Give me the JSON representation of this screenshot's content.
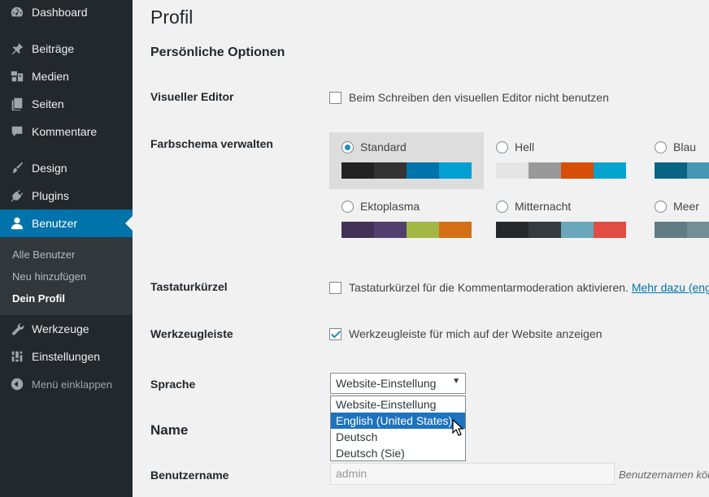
{
  "sidebar": {
    "items": [
      {
        "label": "Dashboard",
        "icon": "dashboard-icon"
      },
      {
        "label": "Beiträge",
        "icon": "pin-icon"
      },
      {
        "label": "Medien",
        "icon": "media-icon"
      },
      {
        "label": "Seiten",
        "icon": "pages-icon"
      },
      {
        "label": "Kommentare",
        "icon": "comment-icon"
      },
      {
        "label": "Design",
        "icon": "brush-icon"
      },
      {
        "label": "Plugins",
        "icon": "plug-icon"
      },
      {
        "label": "Benutzer",
        "icon": "user-icon"
      },
      {
        "label": "Werkzeuge",
        "icon": "wrench-icon"
      },
      {
        "label": "Einstellungen",
        "icon": "settings-icon"
      }
    ],
    "submenu": [
      "Alle Benutzer",
      "Neu hinzufügen",
      "Dein Profil"
    ],
    "collapse_label": "Menü einklappen",
    "active_color": "#0073aa"
  },
  "page": {
    "title": "Profil",
    "section_personal": "Persönliche Optionen",
    "visual_editor": {
      "label": "Visueller Editor",
      "checkbox_text": "Beim Schreiben den visuellen Editor nicht benutzen",
      "checked": false
    },
    "color_scheme": {
      "label": "Farbschema verwalten",
      "selected": "Standard",
      "schemes": [
        {
          "name": "Standard",
          "colors": [
            "#222",
            "#333",
            "#0073aa",
            "#00a0d2"
          ]
        },
        {
          "name": "Hell",
          "colors": [
            "#e5e5e5",
            "#999",
            "#d64e07",
            "#04a4cc"
          ]
        },
        {
          "name": "Blau",
          "colors": [
            "#096484",
            "#4796b3",
            "#52accc",
            "#74b6ce"
          ]
        },
        {
          "name": "Ektoplasma",
          "colors": [
            "#413256",
            "#523f6d",
            "#a3b745",
            "#d46f15"
          ]
        },
        {
          "name": "Mitternacht",
          "colors": [
            "#25282b",
            "#363b3f",
            "#69a8bb",
            "#e14d43"
          ]
        },
        {
          "name": "Meer",
          "colors": [
            "#627c83",
            "#738e96",
            "#9ebaa0",
            "#aa9d88"
          ]
        }
      ]
    },
    "keyboard": {
      "label": "Tastaturkürzel",
      "checkbox_text": "Tastaturkürzel für die Kommentarmoderation aktivieren.",
      "link": "Mehr dazu (eng",
      "checked": false
    },
    "toolbar": {
      "label": "Werkzeugleiste",
      "checkbox_text": "Werkzeugleiste für mich auf der Website anzeigen",
      "checked": true
    },
    "language": {
      "label": "Sprache",
      "selected": "Website-Einstellung",
      "options": [
        "Website-Einstellung",
        "English (United States)",
        "Deutsch",
        "Deutsch (Sie)"
      ],
      "highlighted": "English (United States)"
    },
    "section_name": "Name",
    "username": {
      "label": "Benutzername",
      "value": "admin",
      "description": "Benutzernamen kön"
    }
  }
}
